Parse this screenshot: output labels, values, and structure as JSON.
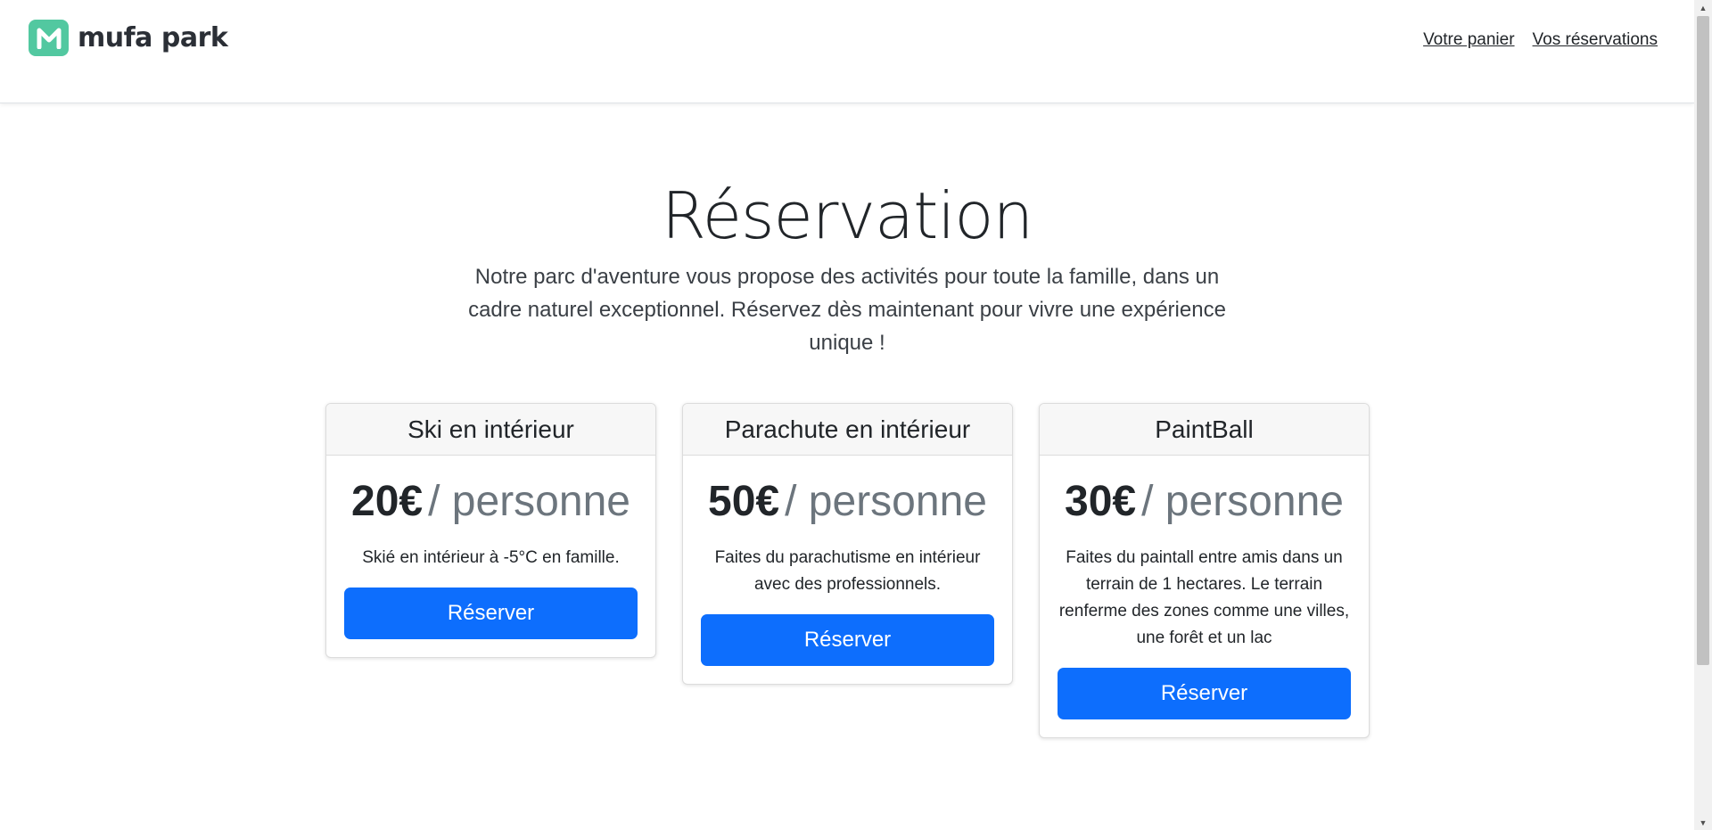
{
  "brand": {
    "name": "mufa park",
    "logo_letter": "M",
    "logo_color": "#52c8a0"
  },
  "nav": {
    "cart": "Votre panier",
    "reservations": "Vos réservations"
  },
  "hero": {
    "title": "Réservation",
    "description": "Notre parc d'aventure vous propose des activités pour toute la famille, dans un cadre naturel exceptionnel. Réservez dès maintenant pour vivre une expérience unique !"
  },
  "activities": [
    {
      "title": "Ski en intérieur",
      "price": "20€",
      "unit": "/ personne",
      "description": "Skié en intérieur à -5°C en famille.",
      "button": "Réserver"
    },
    {
      "title": "Parachute en intérieur",
      "price": "50€",
      "unit": "/ personne",
      "description": "Faites du parachutisme en intérieur avec des professionnels.",
      "button": "Réserver"
    },
    {
      "title": "PaintBall",
      "price": "30€",
      "unit": "/ personne",
      "description": "Faites du paintall entre amis dans un terrain de 1 hectares. Le terrain renferme des zones comme une villes, une forêt et un lac",
      "button": "Réserver"
    }
  ],
  "colors": {
    "primary": "#0d6efd",
    "muted": "#6c757d"
  }
}
